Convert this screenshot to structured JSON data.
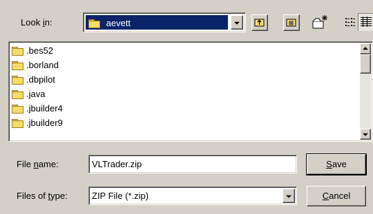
{
  "look_in": {
    "label_pre": "Look ",
    "label_key": "i",
    "label_post": "n:",
    "selected": "aevett",
    "accent": "#0a246a"
  },
  "toolbar": {
    "up_icon": "up-folder-icon",
    "home_icon": "home-folder-icon",
    "new_folder_icon": "new-folder-icon",
    "list_icon": "list-view-icon",
    "details_icon": "details-view-icon"
  },
  "files": [
    {
      "name": ".bes52"
    },
    {
      "name": ".borland"
    },
    {
      "name": ".dbpilot"
    },
    {
      "name": ".java"
    },
    {
      "name": ".jbuilder4"
    },
    {
      "name": ".jbuilder9"
    }
  ],
  "file_name": {
    "label_pre": "File ",
    "label_key": "n",
    "label_post": "ame:",
    "value": "VLTrader.zip"
  },
  "file_type": {
    "label_pre": "Files of ",
    "label_key": "t",
    "label_post": "ype:",
    "value": "ZIP File (*.zip)"
  },
  "buttons": {
    "save_key": "S",
    "save_rest": "ave",
    "cancel_key": "C",
    "cancel_rest": "ancel"
  }
}
